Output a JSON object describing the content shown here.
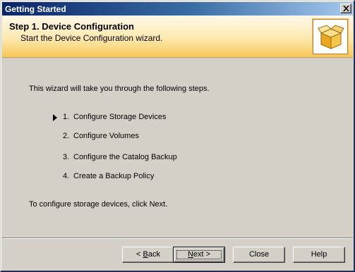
{
  "window": {
    "title": "Getting Started"
  },
  "header": {
    "step_title": "Step 1.  Device Configuration",
    "step_subtitle": "Start the Device Configuration wizard.",
    "icon": "package-box-icon"
  },
  "body": {
    "intro": "This wizard will take you through the following steps.",
    "steps": [
      {
        "number": "1.",
        "label": "Configure Storage Devices",
        "current": true
      },
      {
        "number": "2.",
        "label": "Configure Volumes",
        "current": false
      },
      {
        "number": "3.",
        "label": "Configure the Catalog Backup",
        "current": false
      },
      {
        "number": "4.",
        "label": "Create a Backup Policy",
        "current": false
      }
    ],
    "outro": "To configure storage devices, click Next."
  },
  "buttons": {
    "back": {
      "prefix": "< ",
      "accel": "B",
      "rest": "ack"
    },
    "next": {
      "accel": "N",
      "rest": "ext >"
    },
    "close": "Close",
    "help": "Help"
  },
  "colors": {
    "title_bar_start": "#0a246a",
    "title_bar_end": "#a6caf0",
    "dialog_face": "#d4d0c8",
    "header_band": "#ffe9b0"
  }
}
